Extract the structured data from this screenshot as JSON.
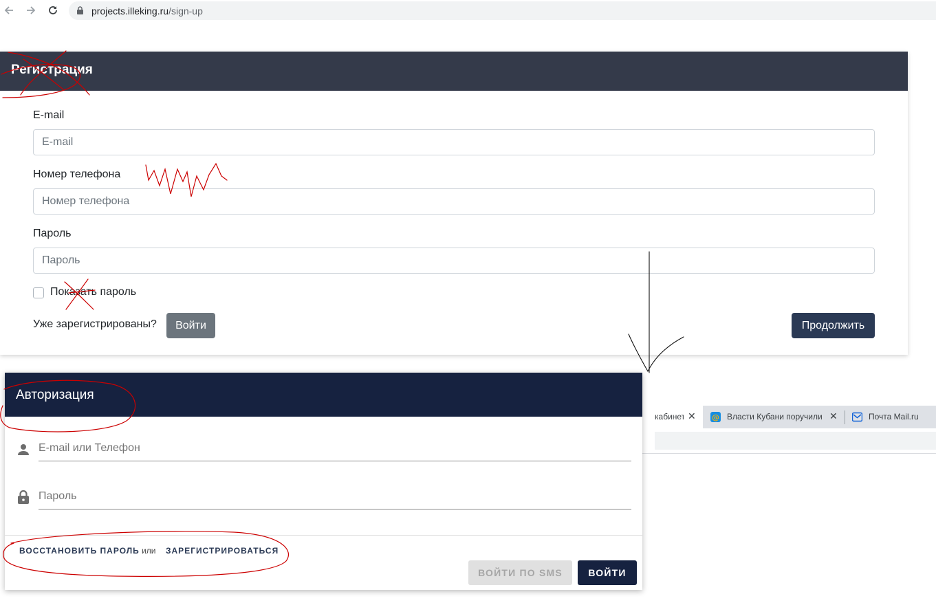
{
  "browser": {
    "url_host": "projects.illeking.ru",
    "url_path": "/sign-up"
  },
  "registration": {
    "title": "Регистрация",
    "email_label": "E-mail",
    "email_placeholder": "E-mail",
    "phone_label": "Номер телефона",
    "phone_placeholder": "Номер телефона",
    "password_label": "Пароль",
    "password_placeholder": "Пароль",
    "show_password_label": "Показать пароль",
    "already_registered": "Уже зарегистрированы?",
    "login_button": "Войти",
    "continue_button": "Продолжить"
  },
  "bg_tabs": [
    {
      "label": "кабинет",
      "active": true
    },
    {
      "label": "Власти Кубани поручили",
      "active": false
    },
    {
      "label": "Почта Mail.ru",
      "active": false
    }
  ],
  "authorization": {
    "title": "Авторизация",
    "login_placeholder": "E-mail или Телефон",
    "password_placeholder": "Пароль",
    "restore_link": "ВОССТАНОВИТЬ ПАРОЛЬ",
    "or_text": "или",
    "register_link": "ЗАРЕГИСТРИРОВАТЬСЯ",
    "sms_button": "ВОЙТИ ПО SMS",
    "login_button": "ВОЙТИ"
  },
  "colors": {
    "reg_header": "#343a4a",
    "auth_header": "#162240",
    "primary_button": "#2b3a55",
    "annotation": "#cc0000"
  }
}
